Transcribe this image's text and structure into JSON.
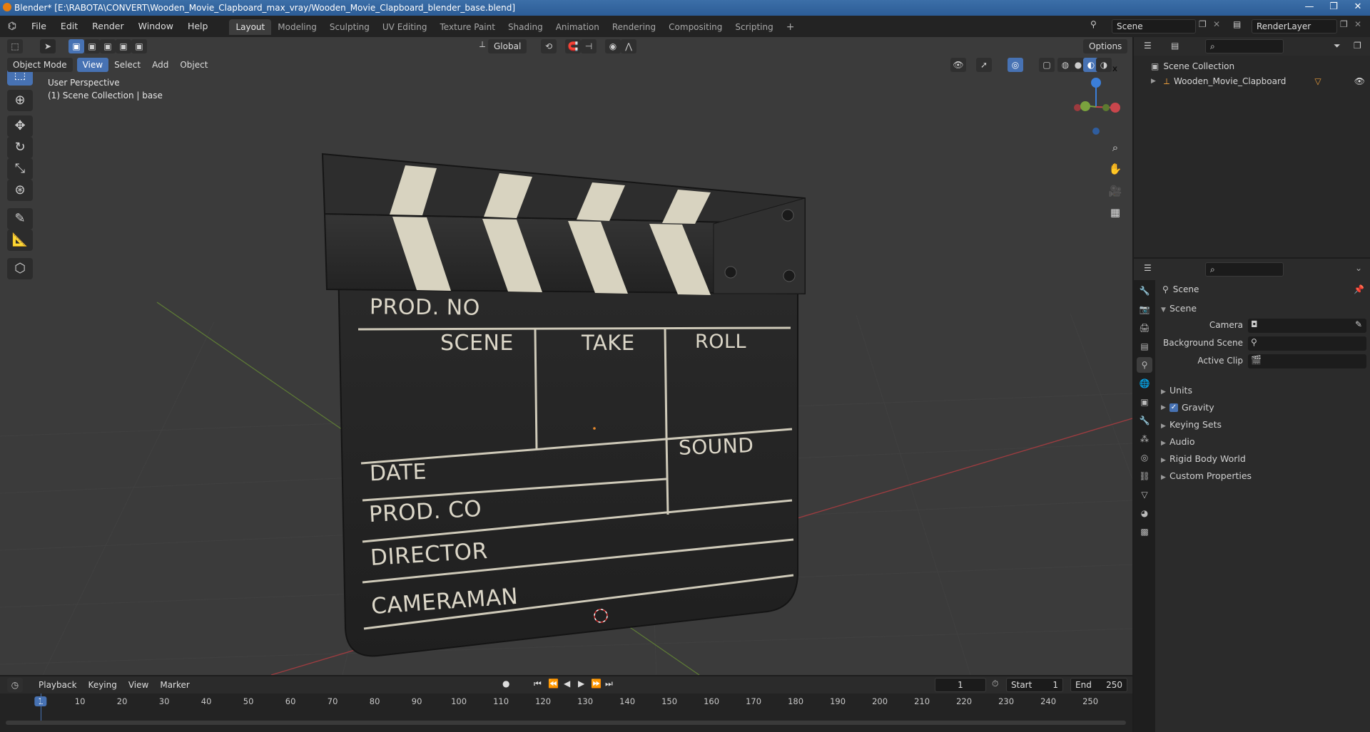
{
  "window": {
    "title": "Blender* [E:\\RABOTA\\CONVERT\\Wooden_Movie_Clapboard_max_vray/Wooden_Movie_Clapboard_blender_base.blend]",
    "minimize": "—",
    "maximize": "❐",
    "close": "✕"
  },
  "menu": [
    "File",
    "Edit",
    "Render",
    "Window",
    "Help"
  ],
  "workspaces": [
    "Layout",
    "Modeling",
    "Sculpting",
    "UV Editing",
    "Texture Paint",
    "Shading",
    "Animation",
    "Rendering",
    "Compositing",
    "Scripting"
  ],
  "active_workspace": "Layout",
  "add_workspace": "+",
  "scene_field": "Scene",
  "render_layer": "RenderLayer",
  "toolbar": {
    "transform_orientation": "Global",
    "options": "Options"
  },
  "viewport": {
    "mode": "Object Mode",
    "menus": [
      "View",
      "Select",
      "Add",
      "Object"
    ],
    "overlay_line1": "User Perspective",
    "overlay_line2": "(1) Scene Collection | base",
    "gizmo": {
      "z": "Z",
      "y": "Y",
      "x": "X"
    }
  },
  "clapboard": {
    "prod_no": "PROD. NO",
    "scene": "SCENE",
    "take": "TAKE",
    "roll": "ROLL",
    "sound": "SOUND",
    "date": "DATE",
    "prod_co": "PROD. CO",
    "director": "DIRECTOR",
    "cameraman": "CAMERAMAN"
  },
  "outliner": {
    "root": "Scene Collection",
    "items": [
      {
        "label": "Wooden_Movie_Clapboard"
      }
    ]
  },
  "properties": {
    "context": "Scene",
    "panel_title": "Scene",
    "fields": [
      {
        "label": "Camera"
      },
      {
        "label": "Background Scene"
      },
      {
        "label": "Active Clip"
      }
    ],
    "subpanels": [
      "Units",
      "Gravity",
      "Keying Sets",
      "Audio",
      "Rigid Body World",
      "Custom Properties"
    ],
    "gravity_checked": true
  },
  "timeline": {
    "menus": [
      "Playback",
      "Keying",
      "View",
      "Marker"
    ],
    "current_frame": "1",
    "start_label": "Start",
    "start_value": "1",
    "end_label": "End",
    "end_value": "250",
    "ruler": [
      "1",
      "10",
      "20",
      "30",
      "40",
      "50",
      "60",
      "70",
      "80",
      "90",
      "100",
      "110",
      "120",
      "130",
      "140",
      "150",
      "160",
      "170",
      "180",
      "190",
      "200",
      "210",
      "220",
      "230",
      "240",
      "250"
    ]
  },
  "colors": {
    "accent": "#4772b3",
    "viewport_bg": "#3b3b3b",
    "axis_x": "#c9464c",
    "axis_y": "#7aa23e",
    "axis_z": "#3b7ed8",
    "timeline_current": "#4772b3"
  }
}
